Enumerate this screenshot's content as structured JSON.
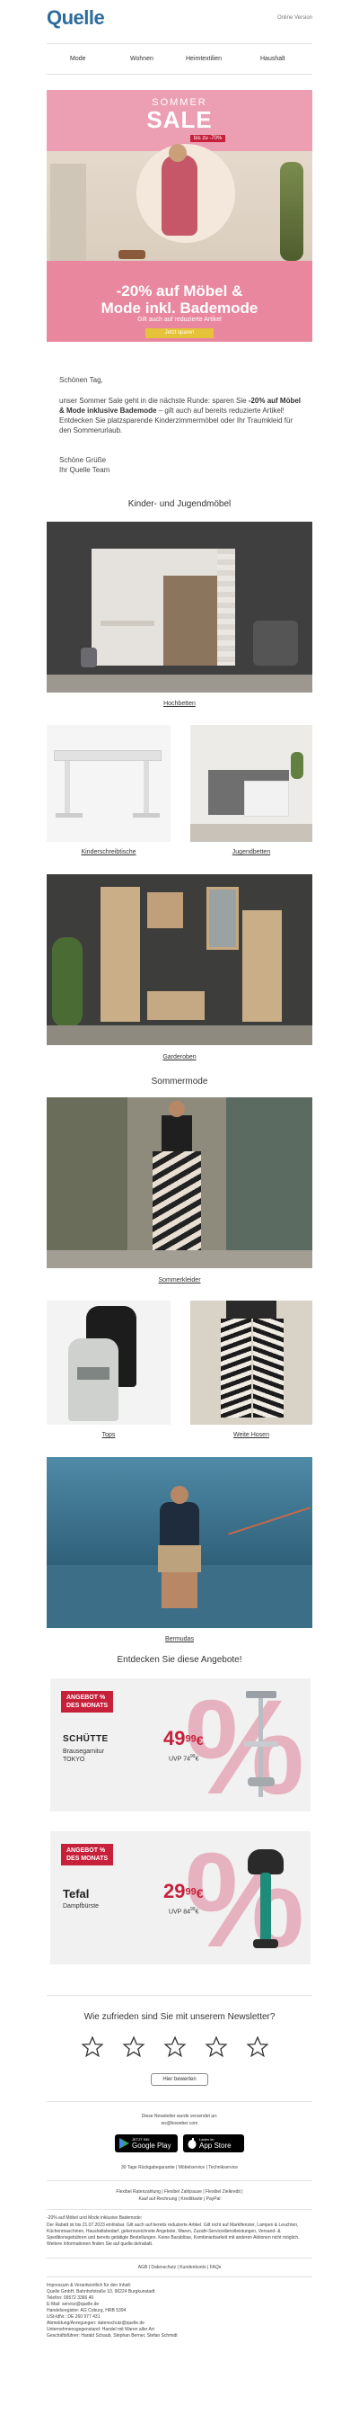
{
  "header": {
    "logo": "Quelle",
    "online_version": "Online Version"
  },
  "nav": [
    "Mode",
    "Wohnen",
    "Heimtextilien",
    "Haushalt"
  ],
  "hero": {
    "sommer": "SOMMER",
    "sale": "SALE",
    "badge": "bis zu -70%",
    "headline1": "-20% auf Möbel &",
    "headline2": "Mode inkl. Bademode",
    "subline": "Gilt auch auf reduzierte Artikel",
    "button": "Jetzt sparen"
  },
  "intro": {
    "greeting": "Schönen Tag,",
    "p1": "unser Sommer Sale geht in die nächste Runde: sparen Sie ",
    "p1_bold": "-20% auf Möbel & Mode inklusive Bademode",
    "p1_rest": " – gilt auch auf bereits reduzierte Artikel! Entdecken Sie platzsparende Kinderzimmermöbel oder Ihr Traumkleid für den Sommerurlaub.",
    "regards": "Schöne Grüße",
    "signature": "Ihr Quelle Team"
  },
  "sections": {
    "kids_title": "Kinder- und Jugendmöbel",
    "hochbetten": "Hochbetten",
    "kinderschreibtische": "Kinderschreibtische",
    "jugendbetten": "Jugendbetten",
    "garderoben": "Garderoben",
    "summer_title": "Sommermode",
    "sommerkleider": "Sommerkleider",
    "tops": "Tops",
    "weite_hosen": "Weite Hosen",
    "bermudas": "Bermudas",
    "offers_title": "Entdecken Sie diese Angebote!"
  },
  "offers": [
    {
      "tag1": "ANGEBOT %",
      "tag2": "DES MONATS",
      "brand": "SCHÜTTE",
      "product1": "Brausegarnitur",
      "product2": "TOKYO",
      "price_main": "49",
      "price_cents": "99",
      "currency": "€",
      "uvp": "UVP 74",
      "uvp_cents": "99",
      "uvp_currency": "€"
    },
    {
      "tag1": "ANGEBOT %",
      "tag2": "DES MONATS",
      "brand": "Tefal",
      "product1": "Dampfbürste",
      "product2": "",
      "price_main": "29",
      "price_cents": "99",
      "currency": "€",
      "uvp": "UVP 84",
      "uvp_cents": "99",
      "uvp_currency": "€"
    }
  ],
  "rating": {
    "question": "Wie zufrieden sind Sie mit unserem Newsletter?",
    "button": "Hier bewerten"
  },
  "footer": {
    "sender_line1": "Diese Newsletter wurde versendet an:",
    "sender_line2": "ws@koweber.com",
    "google_play_small": "JETZT BEI",
    "google_play": "Google Play",
    "app_store_small": "Laden im",
    "app_store": "App Store",
    "returns": "30 Tage Rückgabegarantie | Möbelservice | Technikservice",
    "payment1": "Flexibel Ratenzahlung | Flexibel Zahlpause | Flexibel Zielkredit |",
    "payment2": "Kauf auf Rechnung | Kreditkarte | PayPal",
    "fine1": "-20% auf Möbel und Mode inklusive Bademode:",
    "fine2": "Der Rabatt ist bis 21.07.2023 einlösbar. Gilt auch auf bereits reduzierte Artikel. Gilt nicht auf Marktfenster, Lampen & Leuchten, Küchenmaschinen, Haushaltsbedarf, gekennzeichnete Angebote, Waren, Zuzahl-Servicedienstleistungen, Versand- & Speditionsgebühren und bereits getätigte Bestellungen. Keine Barablöse, Kombinierbarkeit mit anderen Aktionen nicht möglich. Weitere Informationen finden Sie auf quelle.de/rabatt.",
    "links": "AGB | Datenschutz | Kundenkonto | FAQs",
    "imp1": "Impressum & Verantwortlich für den Inhalt:",
    "imp2": "Quelle GmbH, Bahnhofstraße 10, 96224 Burgkunstadt",
    "imp3": "Telefon: 09572 3366 40",
    "imp4": "E-Mail: service@quelle.de",
    "imp5": "Handelsregister: AG Coburg, HRB 5394",
    "imp6": "USt-IdNr.: DE 260 977 431",
    "imp7": "Abmeldung/Anregungen: datenschutz@quelle.de",
    "imp8": "Unternehmensgegenstand: Handel mit Waren aller Art",
    "imp9": "Geschäftsführer: Harald Schaub, Stephan Berner, Stefan Schmidt"
  },
  "colors": {
    "pink": "#e88aa6",
    "magenta": "#c7203a",
    "dark": "#333333"
  }
}
